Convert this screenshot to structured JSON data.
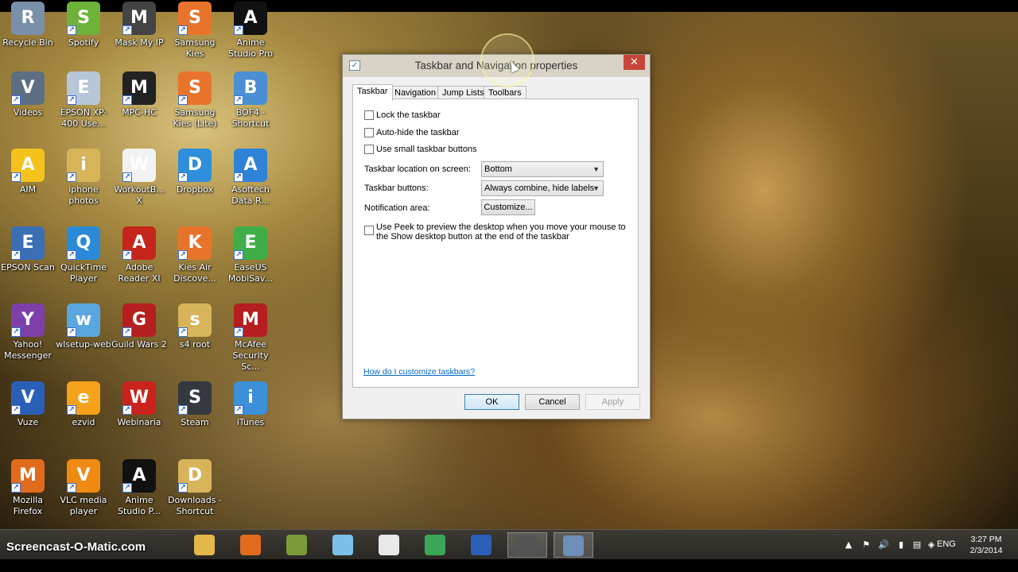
{
  "desktop": {
    "icons": [
      {
        "label": "Recycle Bin",
        "icon": "recycle-bin-icon",
        "color": "#7a8fa8"
      },
      {
        "label": "Spotify",
        "icon": "spotify-icon",
        "color": "#6fb23a"
      },
      {
        "label": "Mask My IP",
        "icon": "mask-icon",
        "color": "#444444"
      },
      {
        "label": "Samsung Kies",
        "icon": "kies-icon",
        "color": "#e8742c"
      },
      {
        "label": "Anime Studio Pro",
        "icon": "anime-studio-icon",
        "color": "#111111"
      },
      {
        "label": "Videos",
        "icon": "video-camera-icon",
        "color": "#5c6f82"
      },
      {
        "label": "EPSON XP-400 Use...",
        "icon": "epson-cd-icon",
        "color": "#b7c6d8"
      },
      {
        "label": "MPC-HC",
        "icon": "mpc-clapper-icon",
        "color": "#222222"
      },
      {
        "label": "Samsung Kies (Lite)",
        "icon": "kies-lite-icon",
        "color": "#e8742c"
      },
      {
        "label": "BOF4 - Shortcut",
        "icon": "bof4-icon",
        "color": "#4a8fd1"
      },
      {
        "label": "AIM",
        "icon": "aim-runner-icon",
        "color": "#f4c21a"
      },
      {
        "label": "iphone photos",
        "icon": "folder-icon",
        "color": "#d7b45a"
      },
      {
        "label": "WorkoutB... X",
        "icon": "document-icon",
        "color": "#f2f2f2"
      },
      {
        "label": "Dropbox",
        "icon": "dropbox-icon",
        "color": "#2e8fdc"
      },
      {
        "label": "Asoftech Data R...",
        "icon": "asoftech-plus-icon",
        "color": "#2f83d6"
      },
      {
        "label": "EPSON Scan",
        "icon": "scanner-icon",
        "color": "#3a6fb6"
      },
      {
        "label": "QuickTime Player",
        "icon": "quicktime-icon",
        "color": "#2a8ad8"
      },
      {
        "label": "Adobe Reader XI",
        "icon": "adobe-reader-icon",
        "color": "#c6251b"
      },
      {
        "label": "Kies Air Discove...",
        "icon": "kies-air-icon",
        "color": "#e8742c"
      },
      {
        "label": "EaseUS MobiSav...",
        "icon": "easeus-icon",
        "color": "#3fae49"
      },
      {
        "label": "Yahoo! Messenger",
        "icon": "yahoo-messenger-icon",
        "color": "#7d3fa8"
      },
      {
        "label": "wlsetup-web",
        "icon": "windows-live-icon",
        "color": "#5aa7e0"
      },
      {
        "label": "Guild Wars 2",
        "icon": "guild-wars-icon",
        "color": "#b51f1f"
      },
      {
        "label": "s4 root",
        "icon": "folder-icon",
        "color": "#d7b45a"
      },
      {
        "label": "McAfee Security Sc...",
        "icon": "mcafee-shield-icon",
        "color": "#b51e1e"
      },
      {
        "label": "Vuze",
        "icon": "vuze-frog-icon",
        "color": "#2a5fb8"
      },
      {
        "label": "ezvid",
        "icon": "ezvid-play-icon",
        "color": "#f5a21a"
      },
      {
        "label": "Webinaria",
        "icon": "webinaria-icon",
        "color": "#c9231c"
      },
      {
        "label": "Steam",
        "icon": "steam-icon",
        "color": "#34393f"
      },
      {
        "label": "iTunes",
        "icon": "itunes-icon",
        "color": "#3c8fd9"
      },
      {
        "label": "Mozilla Firefox",
        "icon": "firefox-icon",
        "color": "#e06b1d"
      },
      {
        "label": "VLC media player",
        "icon": "vlc-cone-icon",
        "color": "#f08a12"
      },
      {
        "label": "Anime Studio P...",
        "icon": "anime-studio-icon",
        "color": "#111111"
      },
      {
        "label": "Downloads - Shortcut",
        "icon": "downloads-folder-icon",
        "color": "#d7b45a"
      }
    ]
  },
  "dialog": {
    "title": "Taskbar and Navigation properties",
    "close_glyph": "✕",
    "tabs": [
      {
        "label": "Taskbar"
      },
      {
        "label": "Navigation"
      },
      {
        "label": "Jump Lists"
      },
      {
        "label": "Toolbars"
      }
    ],
    "options": {
      "lock_taskbar": "Lock the taskbar",
      "auto_hide": "Auto-hide the taskbar",
      "small_buttons": "Use small taskbar buttons"
    },
    "location": {
      "label": "Taskbar location on screen:",
      "value": "Bottom"
    },
    "buttons_setting": {
      "label": "Taskbar buttons:",
      "value": "Always combine, hide labels"
    },
    "notification": {
      "label": "Notification area:",
      "button": "Customize..."
    },
    "peek": "Use Peek to preview the desktop when you move your mouse to the Show desktop button at the end of the taskbar",
    "help_link": "How do I customize taskbars?",
    "ok": "OK",
    "cancel": "Cancel",
    "apply": "Apply"
  },
  "taskbar": {
    "watermark": "Screencast-O-Matic.com",
    "pinned": [
      {
        "icon": "file-explorer-icon",
        "color": "#e2b84a"
      },
      {
        "icon": "firefox-icon",
        "color": "#e06b1d"
      },
      {
        "icon": "guild-wars-icon",
        "color": "#7a9a3a"
      },
      {
        "icon": "windows-explorer-icon",
        "color": "#7cc0e8"
      },
      {
        "icon": "java-icon",
        "color": "#e8e8e8"
      },
      {
        "icon": "chrome-icon",
        "color": "#3aa757"
      },
      {
        "icon": "vuze-frog-icon",
        "color": "#2a5fb8"
      },
      {
        "icon": "screen-capture-icon",
        "color": "#555555"
      },
      {
        "icon": "taskbar-properties-icon",
        "color": "#6f8fb8"
      }
    ],
    "language": "ENG",
    "time": "3:27 PM",
    "date": "2/3/2014"
  }
}
